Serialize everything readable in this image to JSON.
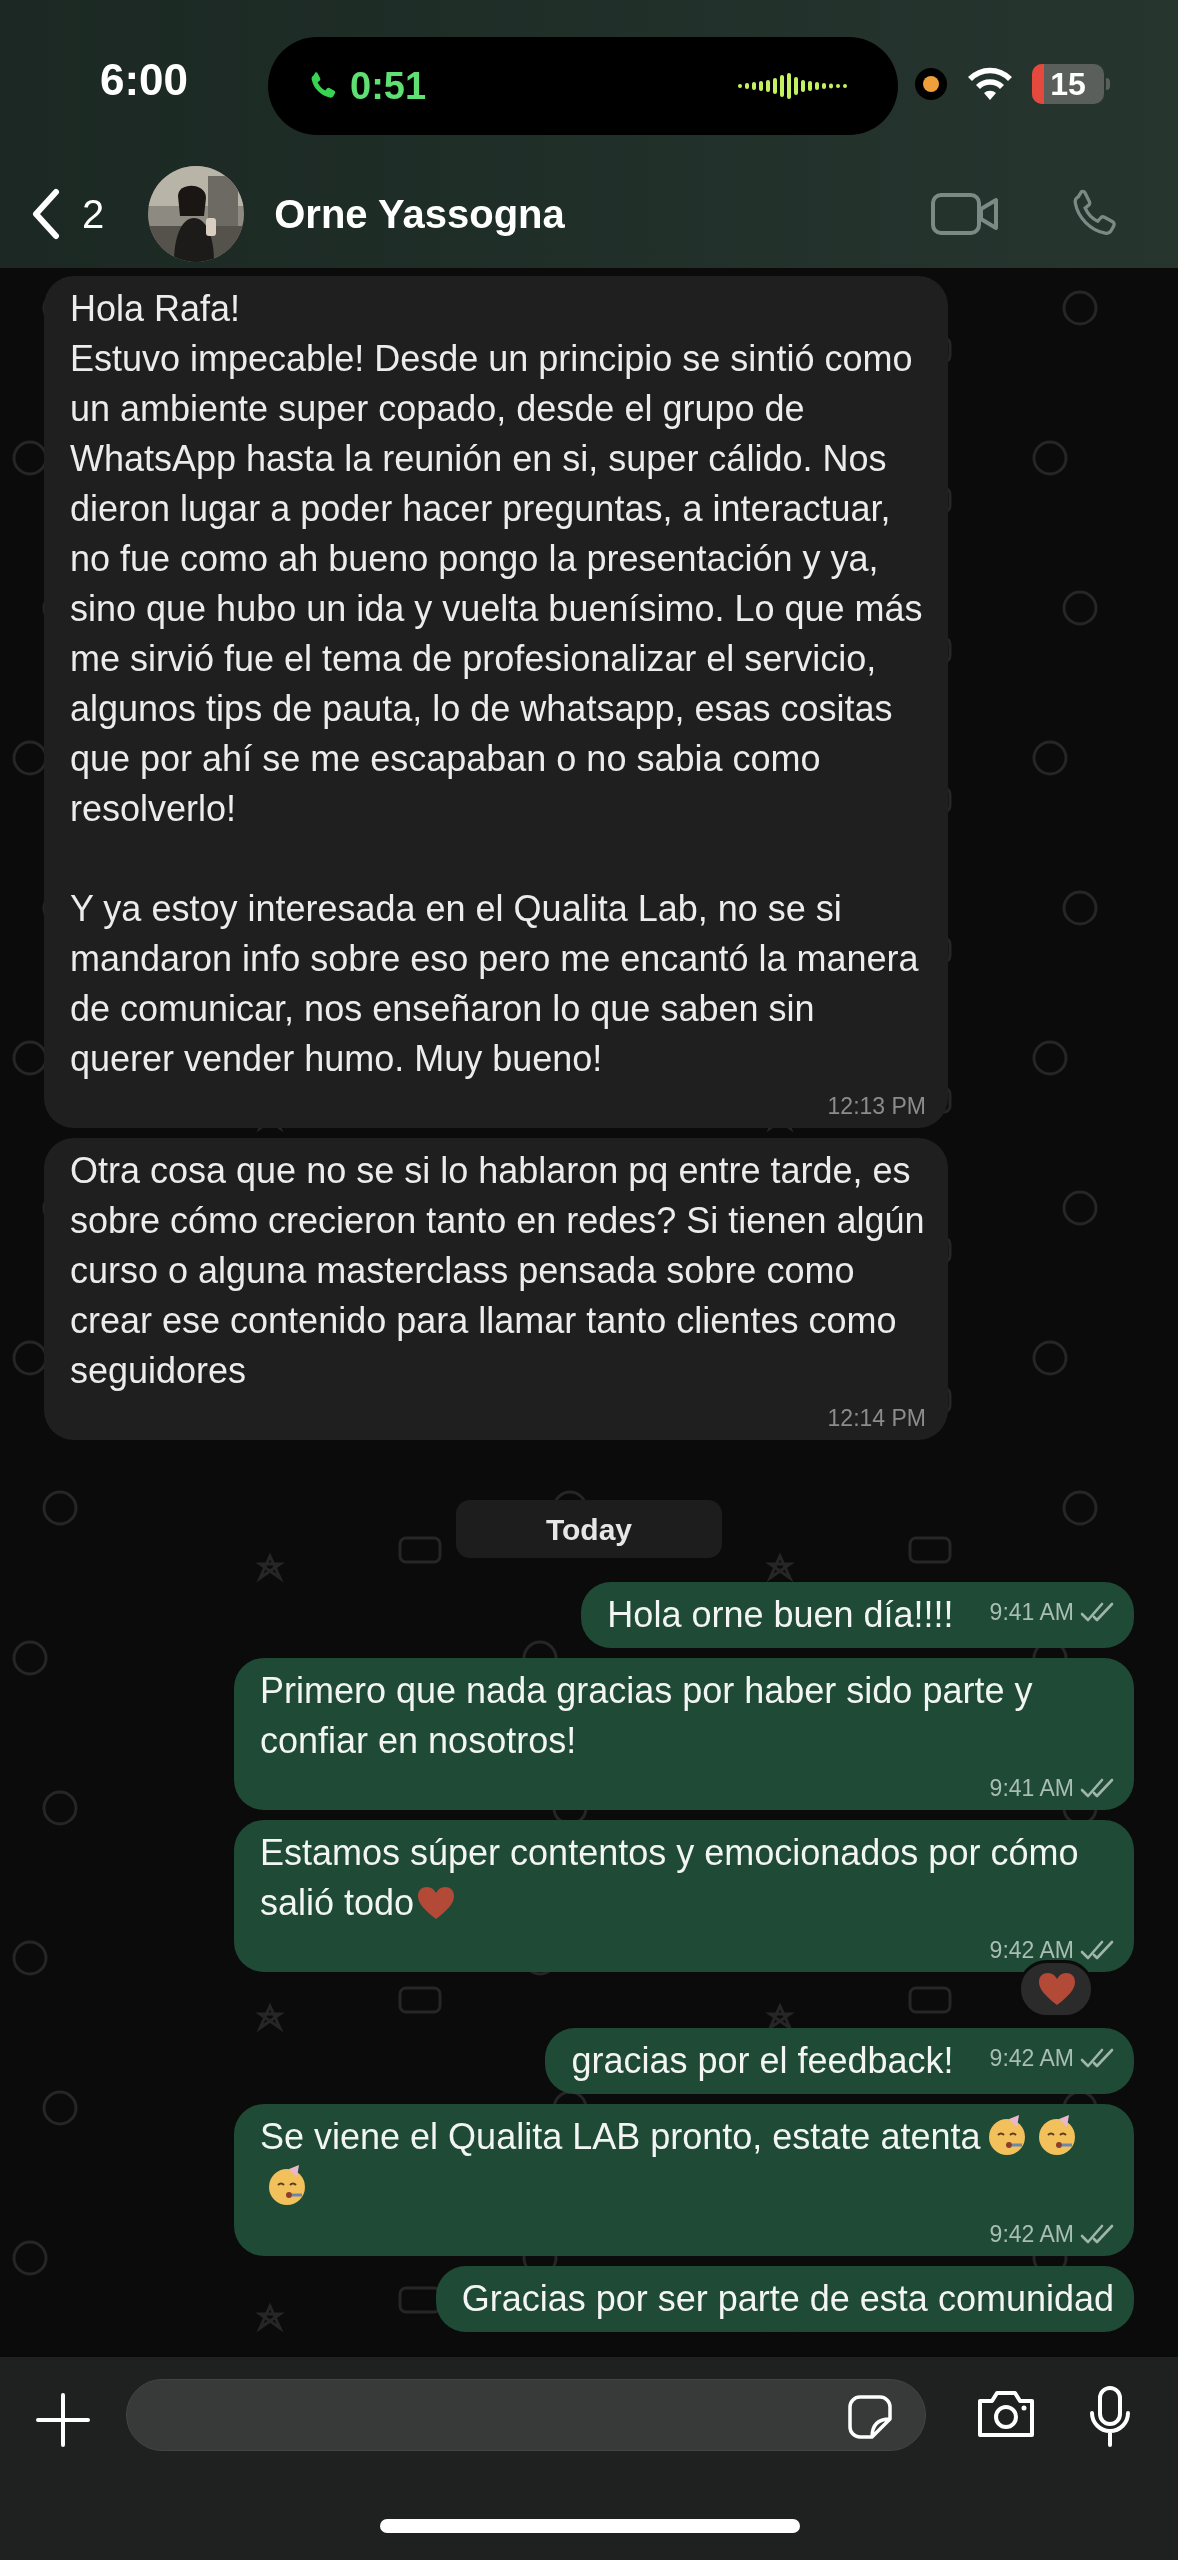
{
  "status_bar": {
    "time": "6:00",
    "call_timer": "0:51",
    "battery": "15"
  },
  "header": {
    "back_count": "2",
    "contact_name": "Orne Yassogna"
  },
  "messages": [
    {
      "kind": "incoming",
      "text": "Hola Rafa!\nEstuvo impecable! Desde un principio se sintió como un ambiente super copado, desde el grupo de WhatsApp hasta la reunión en si, super cálido. Nos dieron lugar a poder hacer preguntas, a interactuar, no fue como ah bueno pongo la presentación y ya, sino que hubo un ida y vuelta buenísimo. Lo que más me sirvió fue el tema de profesionalizar el servicio, algunos tips de pauta, lo de whatsapp, esas cositas que por ahí se me escapaban o no sabia como resolverlo!\n\nY ya estoy interesada en el Qualita Lab, no se si mandaron info sobre eso pero me encantó la manera de comunicar, nos enseñaron lo que saben sin querer vender humo. Muy bueno!",
      "time": "12:13 PM"
    },
    {
      "kind": "incoming",
      "text": "Otra cosa que no se si lo hablaron pq entre tarde, es sobre cómo crecieron tanto en redes? Si tienen algún curso o alguna masterclass pensada sobre como crear ese contenido para llamar tanto clientes como seguidores",
      "time": "12:14 PM"
    },
    {
      "kind": "date",
      "text": "Today"
    },
    {
      "kind": "outgoing",
      "text": "Hola orne buen día!!!!",
      "time": "9:41 AM",
      "read": true
    },
    {
      "kind": "outgoing",
      "text": "Primero que nada gracias por haber sido parte y confiar en nosotros!",
      "time": "9:41 AM",
      "read": true
    },
    {
      "kind": "outgoing",
      "text": "Estamos súper contentos y emocionados por cómo salió todo",
      "emoji": [
        {
          "kind": "heart"
        }
      ],
      "time": "9:42 AM",
      "read": true,
      "reaction": {
        "kind": "heart"
      }
    },
    {
      "kind": "outgoing",
      "text": "gracias por el feedback!",
      "time": "9:42 AM",
      "read": true
    },
    {
      "kind": "outgoing",
      "text": "Se viene el Qualita LAB pronto, estate atenta",
      "emoji": [
        {
          "kind": "party"
        },
        {
          "kind": "party"
        },
        {
          "kind": "party"
        }
      ],
      "time": "9:42 AM",
      "read": true
    },
    {
      "kind": "outgoing",
      "text": "Gracias por ser parte de esta comunidad"
    }
  ]
}
